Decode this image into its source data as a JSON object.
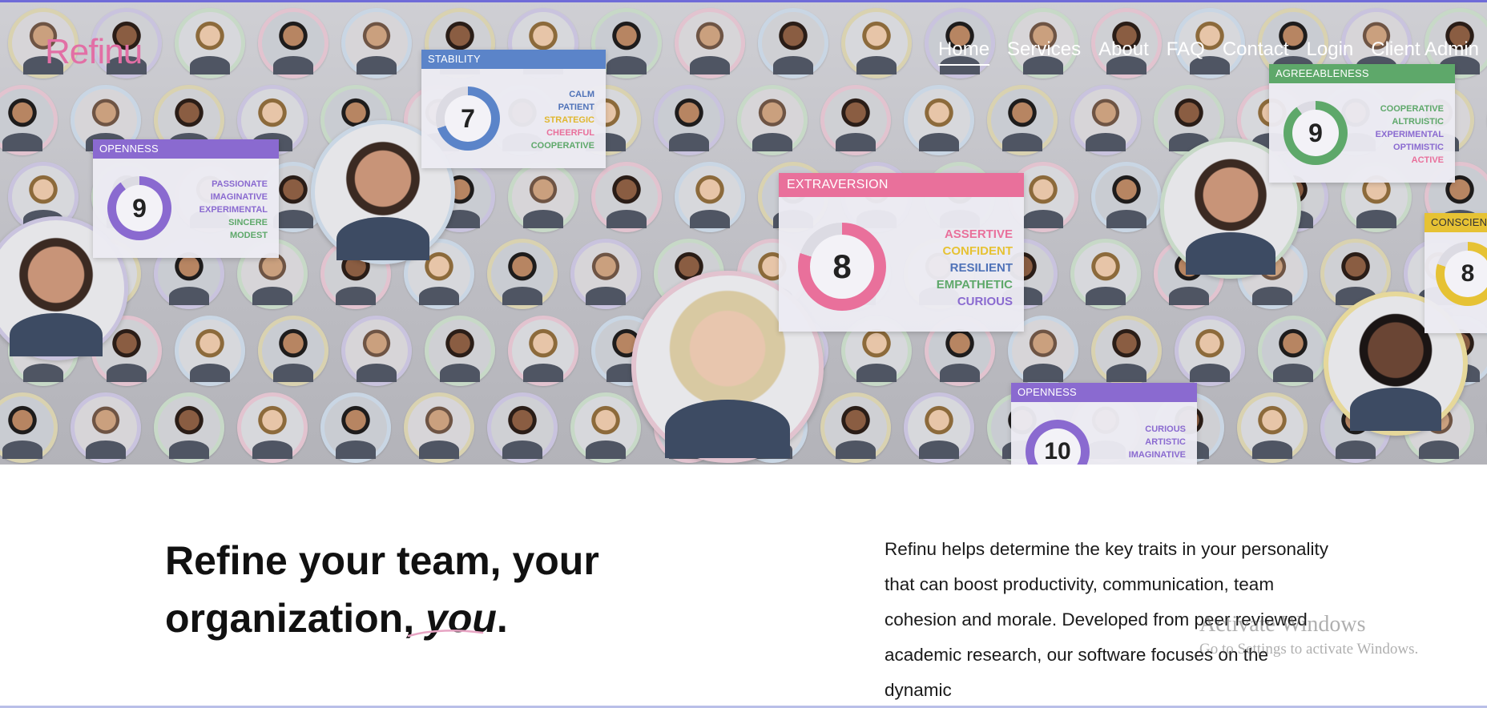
{
  "brand": {
    "logo_text": "Refinu",
    "logo_color": "#e26fa5"
  },
  "nav": {
    "items": [
      {
        "label": "Home",
        "active": true
      },
      {
        "label": "Services"
      },
      {
        "label": "About"
      },
      {
        "label": "FAQ"
      },
      {
        "label": "Contact"
      },
      {
        "label": "Login"
      },
      {
        "label": "Client Admin"
      }
    ]
  },
  "hero": {
    "cards": [
      {
        "title": "STABILITY",
        "score": "7",
        "color": "#5b84c9",
        "traits": [
          "CALM",
          "PATIENT",
          "STRATEGIC",
          "CHEERFUL",
          "COOPERATIVE"
        ]
      },
      {
        "title": "OPENNESS",
        "score": "9",
        "color": "#8a6ad0",
        "traits": [
          "PASSIONATE",
          "IMAGINATIVE",
          "EXPERIMENTAL",
          "SINCERE",
          "MODEST"
        ]
      },
      {
        "title": "EXTRAVERSION",
        "score": "8",
        "color": "#e9709b",
        "traits": [
          "ASSERTIVE",
          "CONFIDENT",
          "RESILIENT",
          "EMPATHETIC",
          "CURIOUS"
        ]
      },
      {
        "title": "AGREEABLENESS",
        "score": "9",
        "color": "#5ea86a",
        "traits": [
          "COOPERATIVE",
          "ALTRUISTIC",
          "EXPERIMENTAL",
          "OPTIMISTIC",
          "ACTIVE"
        ]
      },
      {
        "title": "CONSCIEN",
        "score": "8",
        "color": "#e6c234",
        "traits": []
      },
      {
        "title": "OPENNESS",
        "score": "10",
        "color": "#8a6ad0",
        "traits": [
          "CURIOUS",
          "ARTISTIC",
          "IMAGINATIVE"
        ]
      }
    ]
  },
  "content": {
    "headline_line1": "Refine your team, your",
    "headline_line2": "organization,",
    "headline_em": "you",
    "headline_end": ".",
    "description": "Refinu helps determine the key traits in your personality that can boost productivity, communication, team cohesion and morale. Developed from peer reviewed academic research, our software focuses on the dynamic"
  },
  "watermark": {
    "title": "Activate Windows",
    "subtitle": "Go to Settings to activate Windows."
  }
}
